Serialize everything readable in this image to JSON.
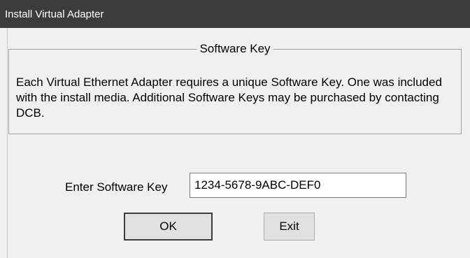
{
  "window": {
    "title": "Install Virtual Adapter"
  },
  "group": {
    "legend": "Software Key",
    "message": "Each Virtual Ethernet Adapter requires a unique Software Key.  One was included with the install media.  Additional Software Keys may be purchased by contacting DCB."
  },
  "form": {
    "key_label": "Enter Software Key",
    "key_value": "1234-5678-9ABC-DEF0"
  },
  "buttons": {
    "ok_label": "OK",
    "exit_label": "Exit"
  },
  "colors": {
    "titlebar": "#3c3c3c",
    "window_bg": "#f0f0f0",
    "button_bg": "#e1e1e1"
  }
}
